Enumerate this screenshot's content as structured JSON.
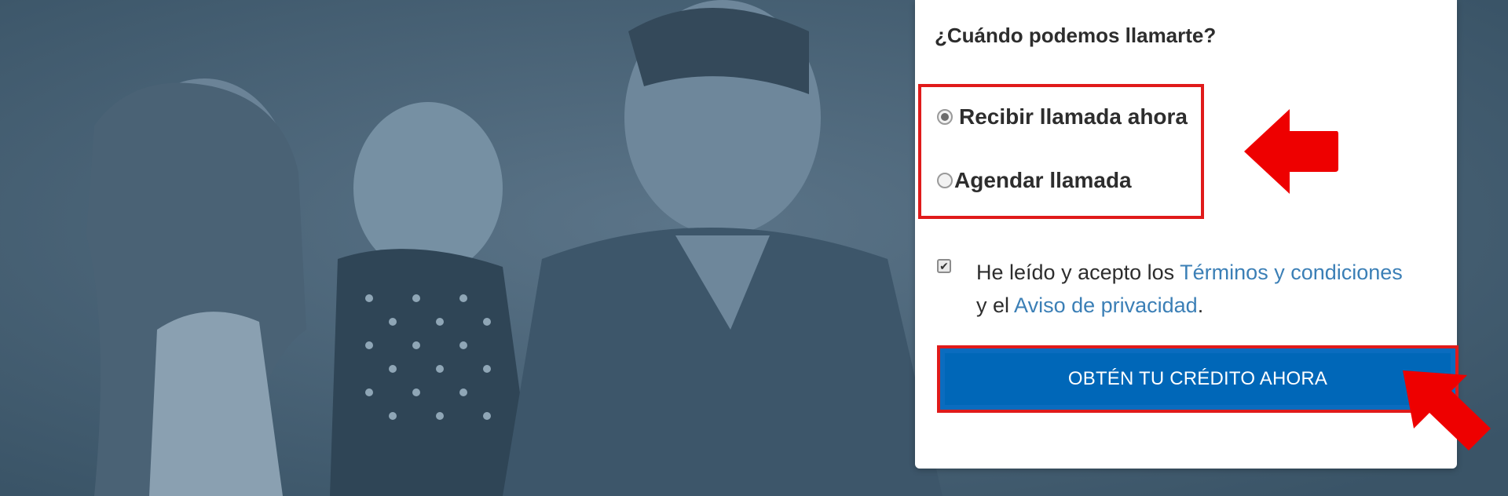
{
  "form": {
    "question": "¿Cuándo podemos llamarte?",
    "options": [
      {
        "label": "Recibir llamada ahora",
        "selected": true
      },
      {
        "label": "Agendar llamada",
        "selected": false
      }
    ],
    "terms": {
      "checked": true,
      "prefix": "He leído y acepto los",
      "terms_link": "Términos y condiciones",
      "middle": "y el",
      "privacy_link": "Aviso de privacidad",
      "suffix": "."
    },
    "cta_label": "OBTÉN TU CRÉDITO AHORA",
    "cta_icon": "chevron-right-icon"
  },
  "colors": {
    "background": "#3f5a6e",
    "cta": "#0067b8",
    "link": "#3b7fb6",
    "annotation": "#e01b1b"
  }
}
